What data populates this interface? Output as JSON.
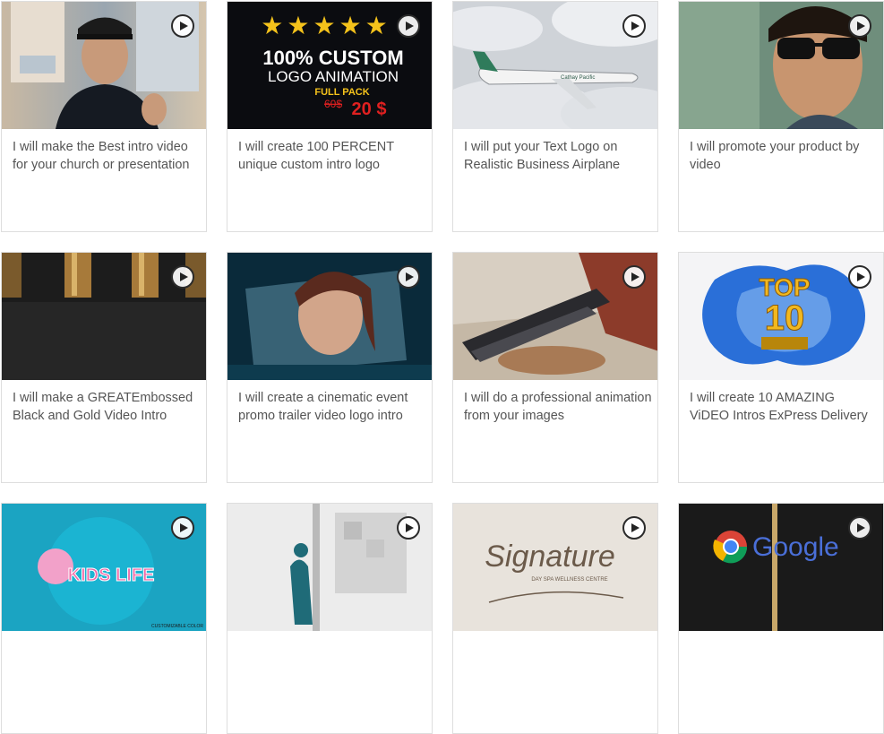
{
  "cards": [
    {
      "title": "I will make the Best intro video for your church or presentation",
      "thumbnail": "man-in-cap-thumbs-up-photo",
      "play_icon": "play-icon"
    },
    {
      "title": "I will create 100 PERCENT unique custom intro logo",
      "thumbnail": "logo-animation-promo-graphic",
      "thumb_text": {
        "stars": "★★★★★",
        "line1": "100% CUSTOM",
        "line2": "LOGO ANIMATION",
        "line3": "FULL PACK",
        "old_price": "60$",
        "new_price": "20 $"
      },
      "play_icon": "play-icon"
    },
    {
      "title": "I will put your Text Logo on Realistic Business Airplane",
      "thumbnail": "airplane-above-clouds-photo",
      "thumb_text": {
        "plane_label": "Cathay Pacific"
      },
      "play_icon": "play-icon"
    },
    {
      "title": "I will promote your product by video",
      "thumbnail": "man-in-sunglasses-photo",
      "play_icon": "play-icon"
    },
    {
      "title": "I will make a GREATEmbossed Black and Gold Video Intro",
      "thumbnail": "black-leather-gold-bars-photo",
      "play_icon": "play-icon"
    },
    {
      "title": "I will create a cinematic event promo trailer video logo intro",
      "thumbnail": "woman-in-glass-panel-photo",
      "play_icon": "play-icon"
    },
    {
      "title": "I will do a professional animation from your images",
      "thumbnail": "fantasy-warrior-with-gun-artwork",
      "play_icon": "play-icon"
    },
    {
      "title": "I will create 10 AMAZING ViDEO Intros ExPress Delivery",
      "thumbnail": "top-10-splash-graphic",
      "thumb_text": {
        "line1": "TOP",
        "line2": "10"
      },
      "play_icon": "play-icon"
    },
    {
      "title": "",
      "thumbnail": "kids-life-cartoon-logo",
      "thumb_text": {
        "logo": "KIDS LIFE",
        "caption": "CUSTOMIZABLE COLOR"
      },
      "play_icon": "play-icon"
    },
    {
      "title": "",
      "thumbnail": "figure-pushing-cube-wall-render",
      "play_icon": "play-icon"
    },
    {
      "title": "",
      "thumbnail": "signature-logo-on-paper",
      "thumb_text": {
        "script": "Signature",
        "sub": "DAY SPA WELLNESS CENTRE"
      },
      "play_icon": "play-icon"
    },
    {
      "title": "",
      "thumbnail": "google-chrome-logo-on-dark",
      "thumb_text": {
        "logo": "Google"
      },
      "play_icon": "play-icon"
    }
  ]
}
